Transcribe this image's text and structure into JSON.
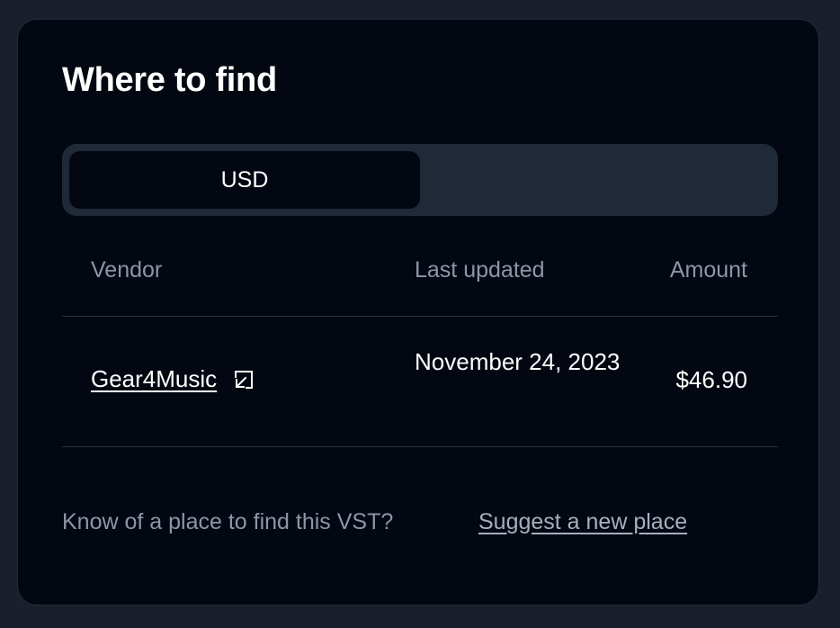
{
  "section": {
    "title": "Where to find"
  },
  "currency_tabs": [
    {
      "label": "USD",
      "selected": true
    }
  ],
  "table": {
    "columns": [
      "Vendor",
      "Last updated",
      "Amount"
    ],
    "rows": [
      {
        "vendor": "Gear4Music",
        "vendor_icon": "external-link-icon",
        "last_updated": "November 24, 2023",
        "amount": "$46.90"
      }
    ]
  },
  "footer": {
    "prompt": "Know of a place to find this VST?",
    "link": "Suggest a new place"
  },
  "colors": {
    "page_bg": "#1a202b",
    "card_bg": "#030711",
    "tab_track_bg": "#1f2937",
    "muted_text": "#8d96a6",
    "text": "#ffffff"
  }
}
